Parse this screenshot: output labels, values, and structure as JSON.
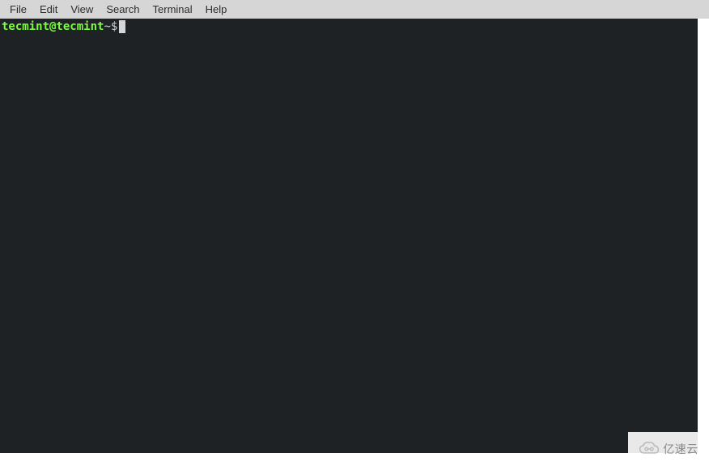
{
  "menubar": {
    "items": [
      "File",
      "Edit",
      "View",
      "Search",
      "Terminal",
      "Help"
    ]
  },
  "terminal": {
    "prompt": {
      "user_host": "tecmint@tecmint",
      "separator_path": " ~ ",
      "symbol": "$ "
    }
  },
  "watermark": {
    "text": "亿速云"
  }
}
